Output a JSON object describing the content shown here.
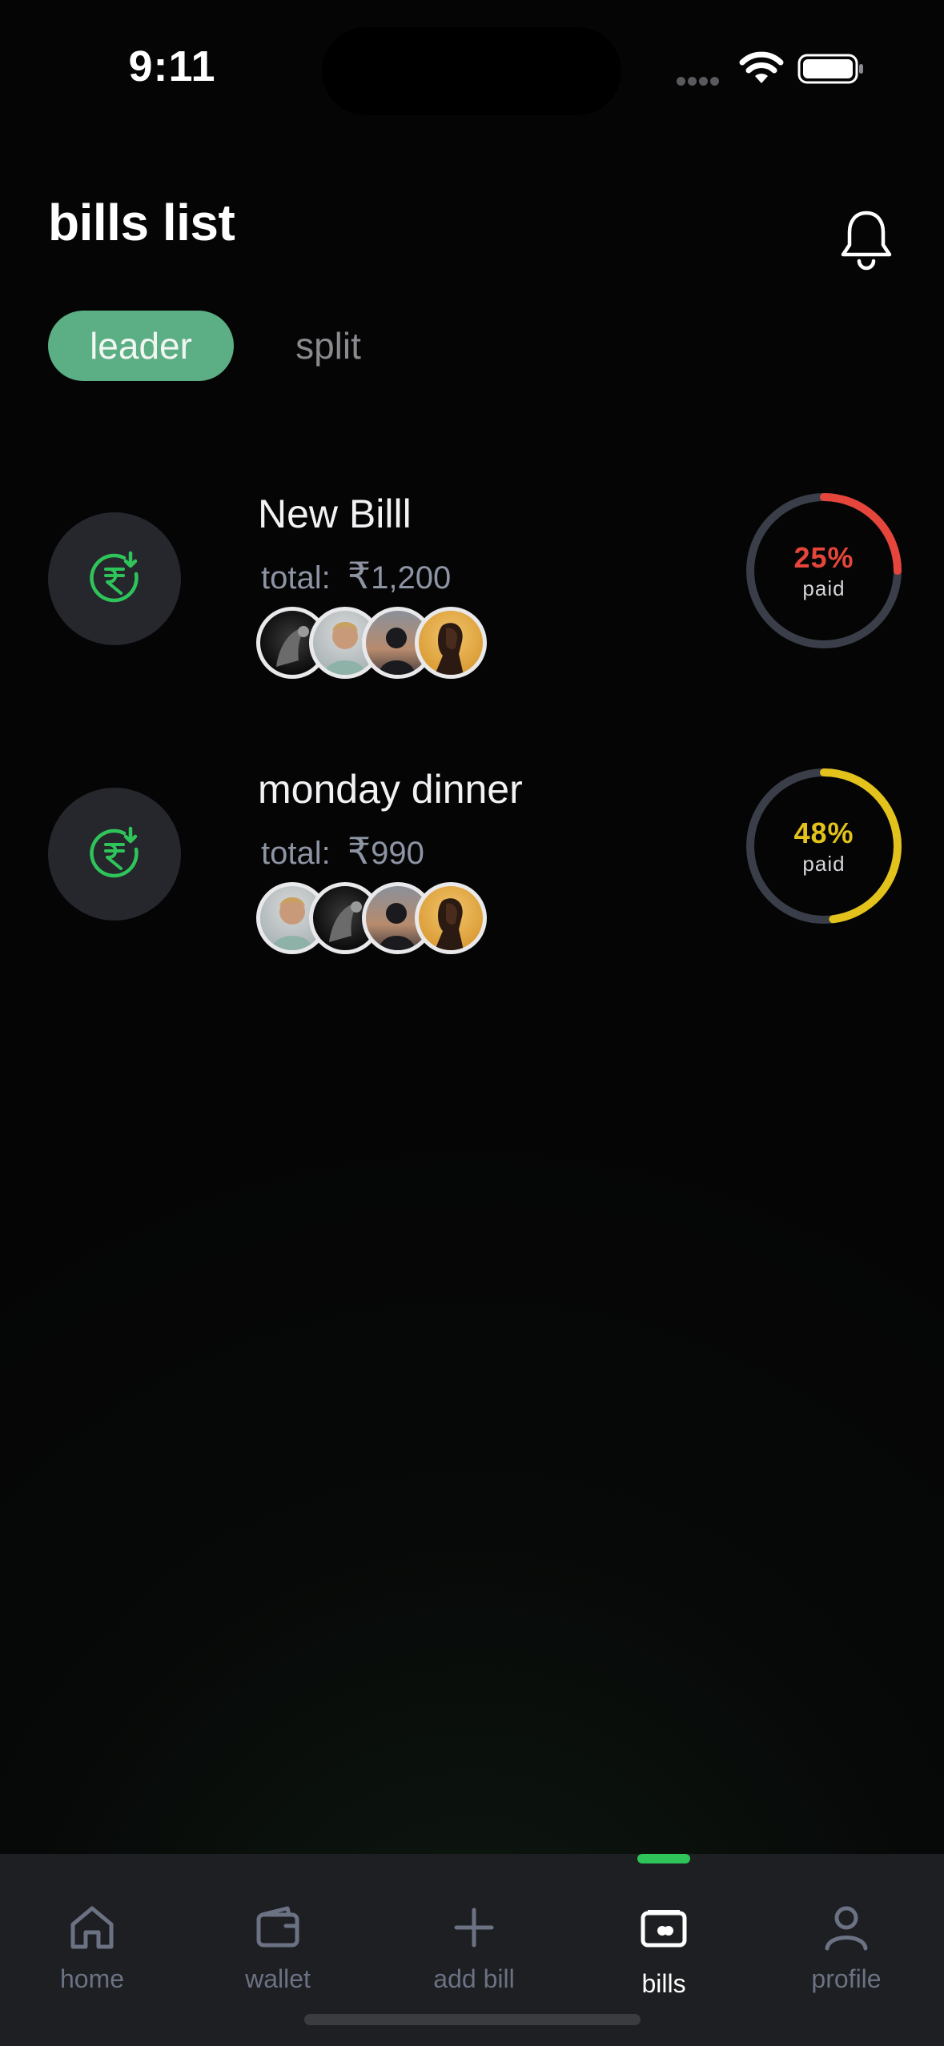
{
  "status_bar": {
    "time": "9:11",
    "wifi_icon": "wifi-icon",
    "battery_icon": "battery-icon"
  },
  "header": {
    "title": "bills list",
    "notification_icon": "bell-icon"
  },
  "filter_tabs": [
    {
      "label": "leader",
      "selected": true
    },
    {
      "label": "split",
      "selected": false
    }
  ],
  "bills": [
    {
      "name": "New Billl",
      "total_label": "total:",
      "total_symbol": "₹",
      "total_amount": "1,200",
      "icon": "rupee-receive-icon",
      "paid_percent": 25,
      "paid_percent_text": "25%",
      "paid_label": "paid",
      "progress_color": "#e5453b",
      "participants": [
        "avatar-eagle",
        "avatar-man-smiling",
        "avatar-silhouette-sunset",
        "avatar-woman-profile"
      ]
    },
    {
      "name": "monday dinner",
      "total_label": "total:",
      "total_symbol": "₹",
      "total_amount": "990",
      "icon": "rupee-receive-icon",
      "paid_percent": 48,
      "paid_percent_text": "48%",
      "paid_label": "paid",
      "progress_color": "#e2c21b",
      "participants": [
        "avatar-man-smiling",
        "avatar-eagle",
        "avatar-silhouette-sunset",
        "avatar-woman-profile"
      ]
    }
  ],
  "tab_bar": {
    "items": [
      {
        "label": "home",
        "icon": "home-icon",
        "active": false
      },
      {
        "label": "wallet",
        "icon": "wallet-icon",
        "active": false
      },
      {
        "label": "add bill",
        "icon": "plus-icon",
        "active": false
      },
      {
        "label": "bills",
        "icon": "bills-icon",
        "active": true
      },
      {
        "label": "profile",
        "icon": "profile-icon",
        "active": false
      }
    ],
    "active_color": "#2fc45a"
  },
  "colors": {
    "accent_green": "#5cae84",
    "icon_green": "#2fc45a",
    "muted_text": "#8d94a3",
    "ring_track": "#3a3e48"
  }
}
